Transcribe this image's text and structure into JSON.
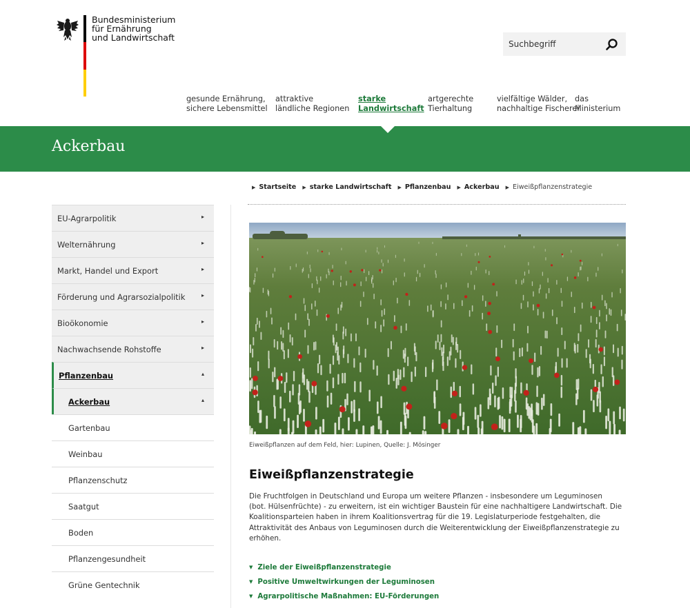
{
  "header": {
    "ministry_lines": [
      "Bundesministerium",
      "für Ernährung",
      "und Landwirtschaft"
    ],
    "flag_colors": [
      "#000000",
      "#dd0000",
      "#ffce00"
    ],
    "eagle_icon": "federal-eagle",
    "search_placeholder": "Suchbegriff",
    "search_icon": "search-icon"
  },
  "topnav": [
    {
      "line1": "gesunde Ernährung,",
      "line2": "sichere Lebensmittel",
      "active": false
    },
    {
      "line1": "attraktive",
      "line2": "ländliche Regionen",
      "active": false
    },
    {
      "line1": "starke",
      "line2": "Landwirtschaft",
      "active": true
    },
    {
      "line1": "artgerechte",
      "line2": "Tierhaltung",
      "active": false
    },
    {
      "line1": "vielfältige Wälder,",
      "line2": "nachhaltige Fischerei",
      "active": false
    },
    {
      "line1": "das",
      "line2": "Ministerium",
      "active": false
    }
  ],
  "band": {
    "title": "Ackerbau",
    "color": "#2c8c49"
  },
  "breadcrumb": [
    "Startseite",
    "starke Landwirtschaft",
    "Pflanzenbau",
    "Ackerbau",
    "Eiweißpflanzenstrategie"
  ],
  "sidebar": [
    {
      "label": "EU-Agrarpolitik",
      "arrow": "▸"
    },
    {
      "label": "Welternährung",
      "arrow": "▸"
    },
    {
      "label": "Markt, Handel und Export",
      "arrow": "▸"
    },
    {
      "label": "Förderung und Agrarsozialpolitik",
      "arrow": "▸"
    },
    {
      "label": "Bioökonomie",
      "arrow": "▸"
    },
    {
      "label": "Nachwachsende Rohstoffe",
      "arrow": "▸"
    },
    {
      "label": "Pflanzenbau",
      "arrow": "▴"
    },
    {
      "label": "Ackerbau",
      "arrow": "▴"
    },
    {
      "label": "Gartenbau",
      "arrow": ""
    },
    {
      "label": "Weinbau",
      "arrow": ""
    },
    {
      "label": "Pflanzenschutz",
      "arrow": ""
    },
    {
      "label": "Saatgut",
      "arrow": ""
    },
    {
      "label": "Boden",
      "arrow": ""
    },
    {
      "label": "Pflanzengesundheit",
      "arrow": ""
    },
    {
      "label": "Grüne Gentechnik",
      "arrow": ""
    }
  ],
  "image": {
    "caption": "Eiweißpflanzen auf dem Feld, hier: Lupinen, Quelle: J. Mösinger"
  },
  "article": {
    "title": "Eiweißpflanzenstrategie",
    "paragraph_lines": [
      "Die Fruchtfolgen in Deutschland und Europa um weitere Pflanzen - insbesondere um Leguminosen",
      "(bot. Hülsenfrüchte) - zu erweitern, ist ein wichtiger Baustein für eine nachhaltigere Landwirtschaft. Die",
      "Koalitionsparteien haben in ihrem Koalitionsvertrag für die 19. Legislaturperiode festgehalten, die",
      "Attraktivität des Anbaus von Leguminosen durch die Weiterentwicklung der Eiweißpflanzenstrategie zu",
      "erhöhen."
    ],
    "links": [
      "Ziele der Eiweißpflanzenstrategie",
      "Positive Umweltwirkungen der Leguminosen",
      "Agrarpolitische Maßnahmen: EU-Förderungen"
    ]
  }
}
